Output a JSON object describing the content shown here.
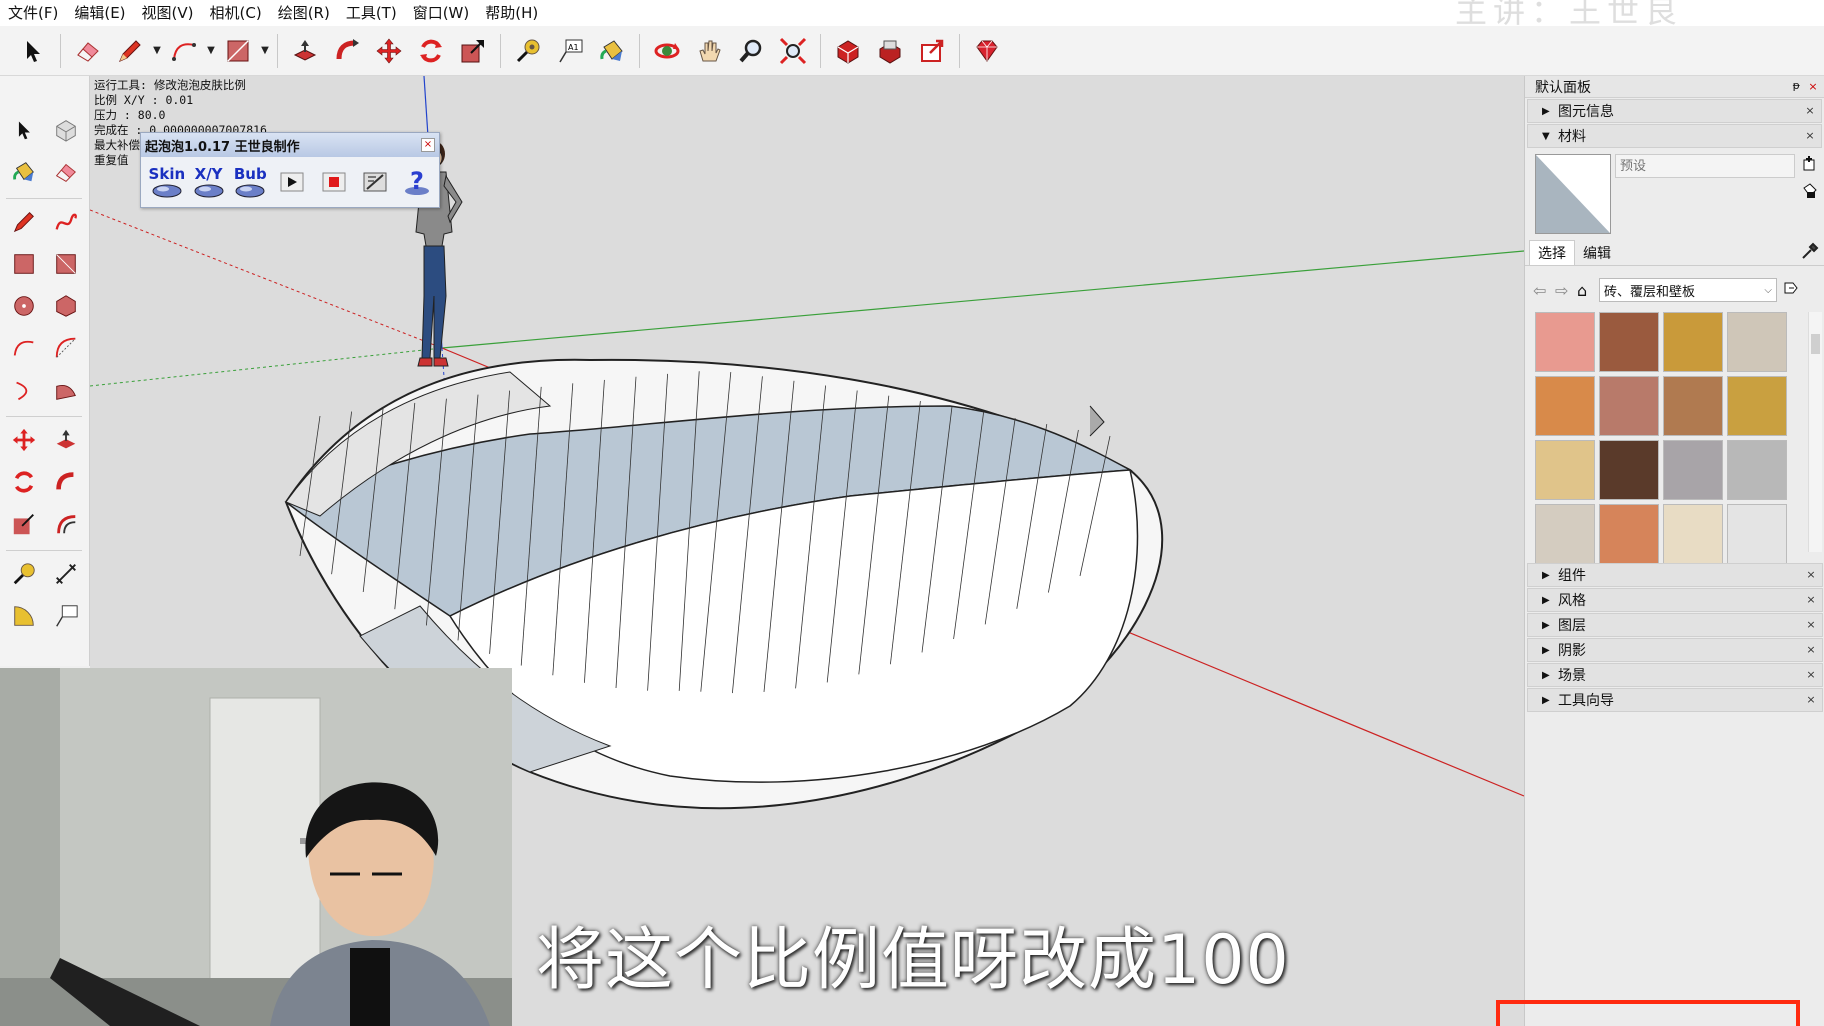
{
  "watermark": "主讲：王世良",
  "menu": [
    "文件(F)",
    "编辑(E)",
    "视图(V)",
    "相机(C)",
    "绘图(R)",
    "工具(T)",
    "窗口(W)",
    "帮助(H)"
  ],
  "status": {
    "lines": [
      "运行工具: 修改泡泡皮肤比例",
      "比例 X/Y : 0.01",
      "压力   : 80.0",
      "完成在   : 0.000000007007816",
      "最大补偿 :",
      "重复值"
    ]
  },
  "plugin": {
    "title": "起泡泡1.0.17 王世良制作",
    "close": "×",
    "buttons": [
      "Skin",
      "X/Y",
      "Bub"
    ]
  },
  "subtitle": "将这个比例值呀改成100",
  "panel": {
    "title": "默认面板",
    "pin": "ᵽ",
    "close": "×",
    "entity_info": "图元信息",
    "materials": "材料",
    "material_name_placeholder": "预设",
    "tab_select": "选择",
    "tab_edit": "编辑",
    "library": "砖、覆层和壁板",
    "sections": [
      "组件",
      "风格",
      "图层",
      "阴影",
      "场景",
      "工具向导"
    ]
  },
  "swatches": [
    "#e89a90",
    "#9a5a3e",
    "#c99a3a",
    "#cfc6b8",
    "#d88a4a",
    "#b87a6a",
    "#b07a50",
    "#c9a040",
    "#e0c48a",
    "#5a3a2a",
    "#a8a4a8",
    "#b8b8b8",
    "#d4ccc0",
    "#d6845a",
    "#e8dcc4",
    "#e4e4e4"
  ],
  "colors": {
    "accent_red": "#ff2a10",
    "axis_green": "#3aa03a",
    "axis_red": "#cc2222",
    "axis_blue": "#2244cc"
  }
}
